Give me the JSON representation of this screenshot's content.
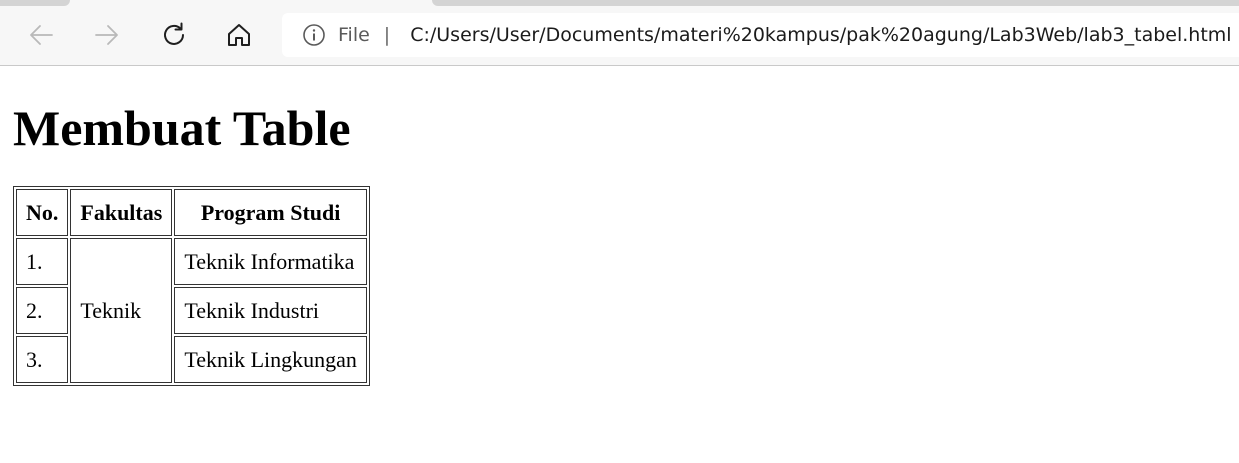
{
  "browser": {
    "url_scheme": "File",
    "url": "C:/Users/User/Documents/materi%20kampus/pak%20agung/Lab3Web/lab3_tabel.html",
    "icons": [
      "back-arrow-icon",
      "forward-arrow-icon",
      "refresh-icon",
      "home-icon",
      "info-icon"
    ]
  },
  "page": {
    "heading": "Membuat Table",
    "table": {
      "headers": [
        "No.",
        "Fakultas",
        "Program Studi"
      ],
      "faculty": "Teknik",
      "rows": [
        {
          "no": "1.",
          "program": "Teknik Informatika"
        },
        {
          "no": "2.",
          "program": "Teknik Industri"
        },
        {
          "no": "3.",
          "program": "Teknik Lingkungan"
        }
      ]
    }
  }
}
